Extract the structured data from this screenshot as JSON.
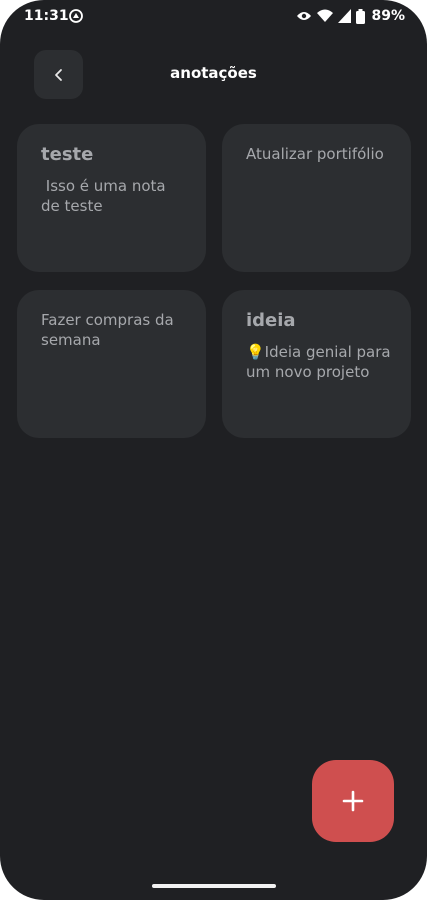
{
  "status_bar": {
    "time": "11:31",
    "battery_percent": "89%",
    "icons": [
      "app-notification-icon",
      "eye-icon",
      "wifi-icon",
      "signal-icon",
      "battery-icon"
    ]
  },
  "header": {
    "title": "anotações",
    "back_icon": "chevron-left-icon"
  },
  "notes": [
    {
      "title": "teste",
      "body": " Isso é uma nota de teste"
    },
    {
      "title": "",
      "body": "Atualizar portifólio"
    },
    {
      "title": "",
      "body": "Fazer compras da semana"
    },
    {
      "title": "ideia",
      "body": "💡Ideia genial para um novo projeto"
    }
  ],
  "fab": {
    "icon": "plus-icon",
    "color": "#cf4f4f"
  },
  "colors": {
    "background": "#1f2023",
    "card": "#2c2e31",
    "text_muted": "#a6a8ac",
    "accent": "#cf4f4f"
  }
}
